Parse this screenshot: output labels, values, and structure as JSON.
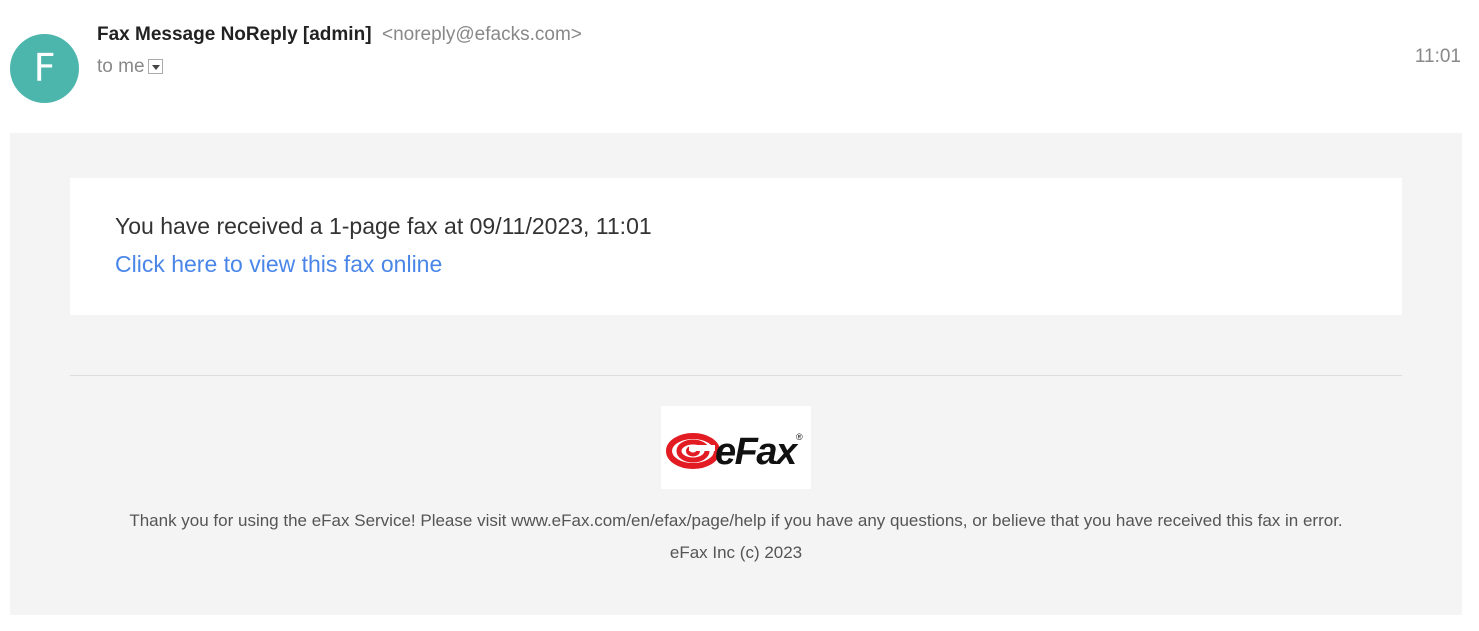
{
  "avatar": {
    "letter": "F",
    "color": "#4db6ac"
  },
  "sender": {
    "name": "Fax Message NoReply [admin]",
    "email": "<noreply@efacks.com>"
  },
  "recipient": {
    "label": "to me",
    "dropdown_icon": "chevron-down-icon"
  },
  "time": "11:01",
  "message": {
    "text": "You have received a 1-page fax at 09/11/2023, 11:01",
    "link_text": "Click here to view this fax online",
    "link_color": "#4a86e8"
  },
  "logo": {
    "text": "eFax",
    "mark": "®",
    "brand_color": "#e31b23"
  },
  "footer": {
    "text": "Thank you for using the eFax Service! Please visit www.eFax.com/en/efax/page/help if you have any questions, or believe that you have received this fax in error.",
    "copyright": "eFax Inc (c) 2023"
  }
}
